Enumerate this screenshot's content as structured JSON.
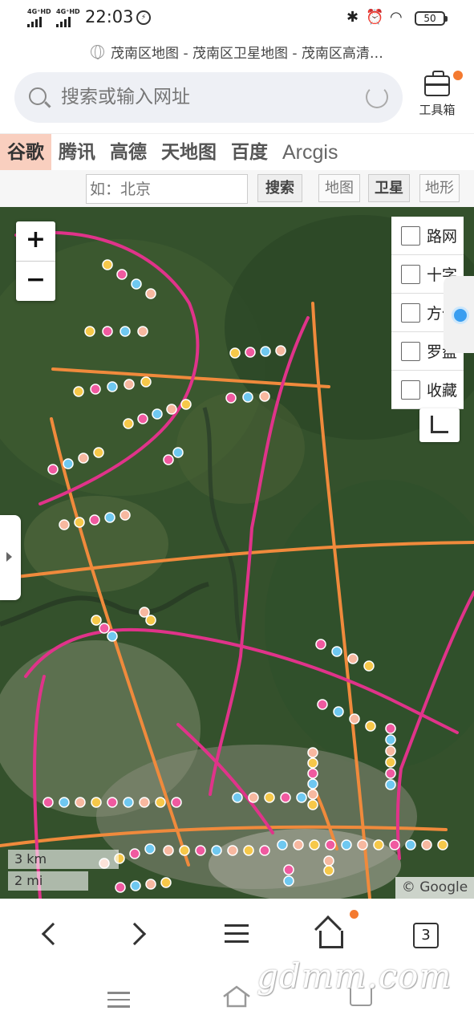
{
  "status_bar": {
    "network1": "4G⁺HD",
    "network2": "4G⁺HD",
    "time": "22:03",
    "battery": "50"
  },
  "page_title": "茂南区地图 - 茂南区卫星地图 - 茂南区高清…",
  "search": {
    "placeholder": "搜索或输入网址",
    "toolbox_label": "工具箱"
  },
  "provider_tabs": [
    "谷歌",
    "腾讯",
    "高德",
    "天地图",
    "百度",
    "Arcgis"
  ],
  "map_search": {
    "placeholder": "如：北京",
    "search_button": "搜索",
    "mode_map": "地图",
    "mode_satellite": "卫星",
    "mode_terrain": "地形"
  },
  "map": {
    "zoom_in": "+",
    "zoom_out": "−",
    "layers": [
      "路网",
      "十字",
      "方位",
      "罗盘",
      "收藏"
    ],
    "scale_km": "3 km",
    "scale_mi": "2 mi",
    "attribution": "© Google"
  },
  "bottom_nav": {
    "tab_count": "3"
  },
  "watermark": "gdmm.com",
  "colors": {
    "accent": "#f47a30",
    "route_pink": "#e0338a",
    "route_orange": "#f08a3c",
    "active_tab_bg": "#f9cfbf"
  }
}
